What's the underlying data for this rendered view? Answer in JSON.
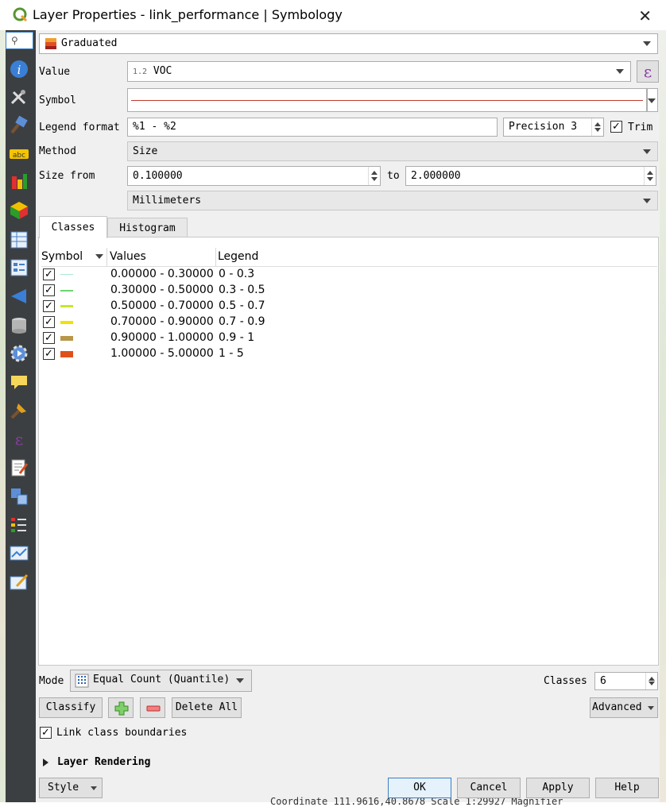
{
  "window": {
    "title": "Layer Properties - link_performance | Symbology",
    "close_glyph": "✕"
  },
  "sidebar": {
    "search_glyph": "⚲",
    "icons": [
      "information-icon",
      "source-icon",
      "symbology-icon",
      "labels-icon",
      "diagrams-icon",
      "3d-view-icon",
      "fields-icon",
      "attributes-form-icon",
      "joins-icon",
      "auxiliary-storage-icon",
      "actions-icon",
      "display-icon",
      "rendering-icon",
      "variables-icon",
      "metadata-icon",
      "dependencies-icon",
      "legend-icon",
      "qgis-server-icon",
      "digitizing-icon"
    ]
  },
  "renderer": {
    "value": "Graduated"
  },
  "value_row": {
    "label": "Value",
    "type_prefix": "1.2",
    "field": "VOC",
    "expression_glyph": "ε"
  },
  "symbol_row": {
    "label": "Symbol",
    "line_color": "#c0392b"
  },
  "legend_format": {
    "label": "Legend format",
    "value": "%1 - %2",
    "precision_label": "Precision 3",
    "trim_label": "Trim",
    "trim_checked": true
  },
  "method": {
    "label": "Method",
    "value": "Size"
  },
  "size_from": {
    "label": "Size from",
    "from_value": "0.100000",
    "to_label": "to",
    "to_value": "2.000000"
  },
  "unit": {
    "value": "Millimeters"
  },
  "tabs": [
    {
      "label": "Classes",
      "active": true
    },
    {
      "label": "Histogram",
      "active": false
    }
  ],
  "table": {
    "headers": [
      "Symbol",
      "Values",
      "Legend"
    ],
    "rows": [
      {
        "checked": true,
        "color": "#a8e8d0",
        "thickness": 1,
        "values": "0.00000 - 0.30000",
        "legend": "0 - 0.3"
      },
      {
        "checked": true,
        "color": "#6dd66d",
        "thickness": 2,
        "values": "0.30000 - 0.50000",
        "legend": "0.3 - 0.5"
      },
      {
        "checked": true,
        "color": "#c8e62a",
        "thickness": 3,
        "values": "0.50000 - 0.70000",
        "legend": "0.5 - 0.7"
      },
      {
        "checked": true,
        "color": "#f2e200",
        "thickness": 4,
        "values": "0.70000 - 0.90000",
        "legend": "0.7 - 0.9"
      },
      {
        "checked": true,
        "color": "#b8964a",
        "thickness": 6,
        "values": "0.90000 - 1.00000",
        "legend": "0.9 - 1"
      },
      {
        "checked": true,
        "color": "#e0501a",
        "thickness": 8,
        "values": "1.00000 - 5.00000",
        "legend": "1 - 5"
      }
    ]
  },
  "mode": {
    "label": "Mode",
    "value": "Equal Count (Quantile)",
    "classes_label": "Classes",
    "classes_value": "6"
  },
  "actions": {
    "classify": "Classify",
    "delete_all": "Delete All",
    "advanced": "Advanced"
  },
  "link_boundaries": {
    "label": "Link class boundaries",
    "checked": true
  },
  "layer_rendering": {
    "label": "Layer Rendering"
  },
  "footer": {
    "style": "Style",
    "ok": "OK",
    "cancel": "Cancel",
    "apply": "Apply",
    "help": "Help"
  },
  "statusbar": {
    "text": "Coordinate   111.9616,40.8678   Scale 1:29927   Magnifier"
  }
}
